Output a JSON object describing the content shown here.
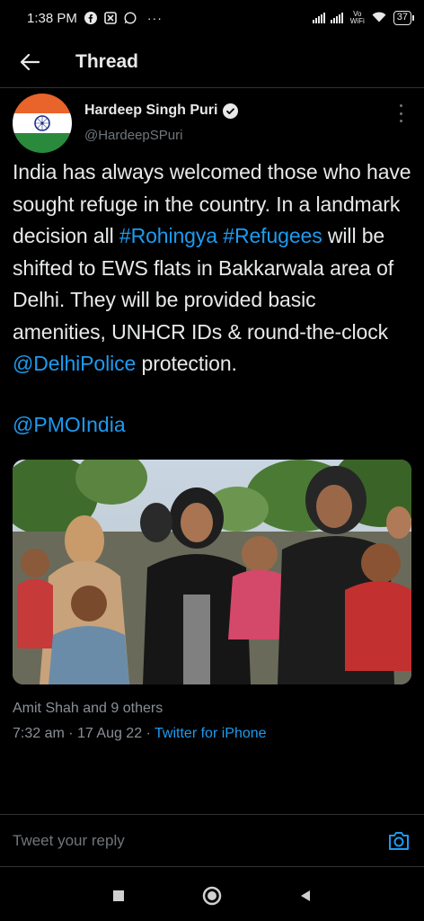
{
  "status_bar": {
    "time": "1:38 PM",
    "dots": "···",
    "network_label": "Vo WiFi",
    "battery": "37"
  },
  "header": {
    "title": "Thread"
  },
  "tweet": {
    "author_name": "Hardeep Singh Puri",
    "author_handle": "@HardeepSPuri",
    "text_parts": {
      "p1": "India has always welcomed those who have sought refuge in the country. In a landmark decision all ",
      "hashtag1": "#Rohingya",
      "space": " ",
      "hashtag2": "#Refugees",
      "p2": " will be shifted to EWS flats in Bakkarwala area of Delhi. They will be provided basic amenities, UNHCR IDs & round-the-clock ",
      "mention1": "@DelhiPolice",
      "p3": " protection."
    },
    "mention2": "@PMOIndia",
    "likers": "Amit Shah and 9 others",
    "timestamp": "7:32 am · 17 Aug 22 · ",
    "source": "Twitter for iPhone"
  },
  "reply": {
    "placeholder": "Tweet your reply"
  },
  "colors": {
    "background": "#000000",
    "accent": "#1d9bf0",
    "secondary_text": "#71767b"
  },
  "icons": {
    "back": "arrow-left-icon",
    "verified": "verified-badge-icon",
    "more": "more-vertical-icon",
    "camera": "camera-icon",
    "nav_recent": "square-icon",
    "nav_home": "circle-icon",
    "nav_back": "triangle-back-icon"
  }
}
